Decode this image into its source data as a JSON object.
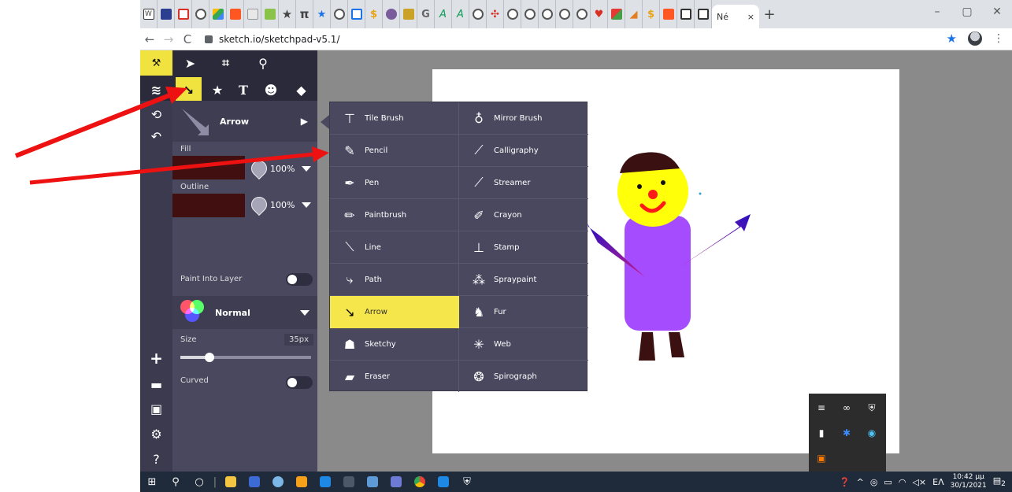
{
  "browser": {
    "tab_title": "Né",
    "tab_close": "×",
    "new_tab": "+",
    "url": "sketch.io/sketchpad-v5.1/",
    "window_controls": {
      "minimize": "–",
      "restore": "▢",
      "close": "✕"
    }
  },
  "toolbar": {
    "tools_row1": [
      "tools",
      "select",
      "crop",
      "zoom"
    ],
    "tools_row2": [
      "layers",
      "arrow-brush",
      "stamp-star",
      "text",
      "emoji",
      "fill"
    ],
    "text_tool_glyph": "T"
  },
  "rail": {
    "top": [
      "history",
      "undo"
    ],
    "bottom": [
      "add",
      "folder",
      "save",
      "settings",
      "help"
    ]
  },
  "panel": {
    "tool_name": "Arrow",
    "fill_label": "Fill",
    "fill_opacity": "100%",
    "outline_label": "Outline",
    "outline_opacity": "100%",
    "paint_into_layer_label": "Paint Into Layer",
    "blend_mode": "Normal",
    "size_label": "Size",
    "size_value": "35px",
    "size_fraction": 0.22,
    "curved_label": "Curved",
    "colors": {
      "fill": "#420f10",
      "outline": "#420f10",
      "accent": "#f0e33f"
    }
  },
  "brush_menu": {
    "left": [
      "Tile Brush",
      "Pencil",
      "Pen",
      "Paintbrush",
      "Line",
      "Path",
      "Arrow",
      "Sketchy",
      "Eraser"
    ],
    "right": [
      "Mirror Brush",
      "Calligraphy",
      "Streamer",
      "Crayon",
      "Stamp",
      "Spraypaint",
      "Fur",
      "Web",
      "Spirograph"
    ],
    "selected": "Arrow"
  },
  "taskbar": {
    "clock_time": "10:42 μμ",
    "clock_date": "30/1/2021",
    "lang": "ΕΛ",
    "notifications": "2"
  }
}
